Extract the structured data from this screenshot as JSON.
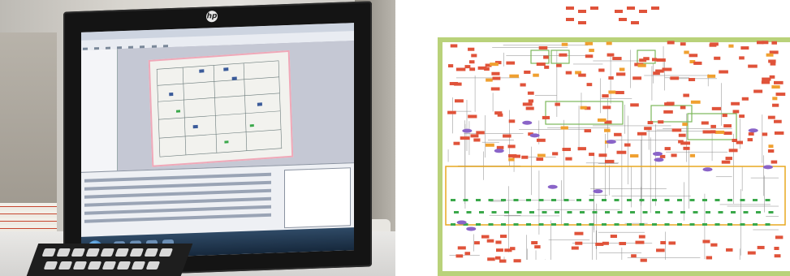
{
  "photo": {
    "monitor_brand": "hp",
    "description_colors": {
      "bezel": "#141414",
      "screen": "#d9dbe2",
      "taskbar": "#1f3550",
      "sheet_border": "#f0a8b8"
    }
  },
  "diagram": {
    "colors": {
      "frame": "#b9d27a",
      "node_red": "#e0533a",
      "node_orange": "#f0a030",
      "node_green": "#3aa84a",
      "node_purple": "#8a64c8",
      "edge": "#8a8a8a",
      "highlight_box": "#e8a820",
      "compartment": "#7bb85a"
    }
  }
}
